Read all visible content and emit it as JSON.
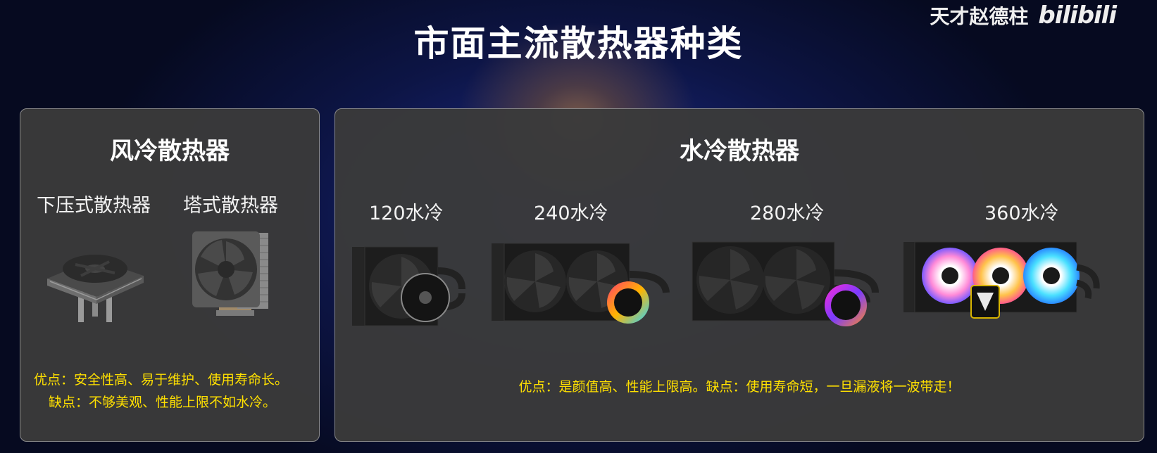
{
  "slide": {
    "title": "市面主流散热器种类",
    "watermark_author": "天才赵德柱",
    "watermark_logo": "bilibili"
  },
  "air_cooling": {
    "heading": "风冷散热器",
    "types": [
      {
        "label": "下压式散热器",
        "icon": "top-down-cooler-icon"
      },
      {
        "label": "塔式散热器",
        "icon": "tower-cooler-icon"
      }
    ],
    "pros": "优点：安全性高、易于维护、使用寿命长。",
    "cons": "缺点：不够美观、性能上限不如水冷。"
  },
  "water_cooling": {
    "heading": "水冷散热器",
    "types": [
      {
        "label": "120水冷",
        "icon": "aio-120-icon"
      },
      {
        "label": "240水冷",
        "icon": "aio-240-icon"
      },
      {
        "label": "280水冷",
        "icon": "aio-280-icon"
      },
      {
        "label": "360水冷",
        "icon": "aio-360-icon"
      }
    ],
    "note": "优点：是颜值高、性能上限高。缺点：使用寿命短，一旦漏液将一波带走！"
  },
  "colors": {
    "panel_bg": "#3a3a3a",
    "panel_border": "#8a8a8a",
    "note_text": "#ffe000",
    "background": "#0d1546"
  }
}
